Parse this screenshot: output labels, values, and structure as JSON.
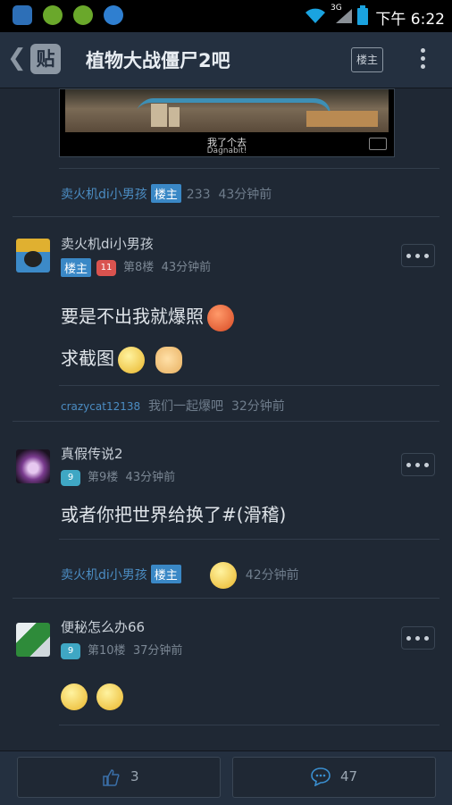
{
  "status_bar": {
    "time": "下午 6:22",
    "network": "3G"
  },
  "header": {
    "title": "植物大战僵尸2吧",
    "logo_text": "贴",
    "floor_owner_button": "楼主"
  },
  "image_post": {
    "caption_cn": "我了个去",
    "caption_en": "Dagnabit!"
  },
  "reply_top": {
    "author": "卖火机di小男孩",
    "badge": "楼主",
    "text": "233",
    "time": "43分钟前"
  },
  "posts": [
    {
      "username": "卖火机di小男孩",
      "owner_badge": "楼主",
      "level": "11",
      "floor": "第8楼",
      "time": "43分钟前",
      "lines": [
        "要是不出我就爆照",
        "求截图"
      ],
      "reply": {
        "author": "crazycat12138",
        "text": "我们一起爆吧",
        "time": "32分钟前"
      }
    },
    {
      "username": "真假传说2",
      "level": "9",
      "floor": "第9楼",
      "time": "43分钟前",
      "lines": [
        "或者你把世界给换了#(滑稽)"
      ],
      "reply": {
        "author": "卖火机di小男孩",
        "badge": "楼主",
        "time": "42分钟前"
      }
    },
    {
      "username": "便秘怎么办66",
      "level": "9",
      "floor": "第10楼",
      "time": "37分钟前"
    }
  ],
  "bottom_bar": {
    "likes": "3",
    "comments": "47"
  },
  "colors": {
    "background": "#1f2834",
    "header": "#243040",
    "accent_blue": "#3a88c6",
    "level_red": "#d9534f",
    "level_teal": "#3fa7c4"
  }
}
